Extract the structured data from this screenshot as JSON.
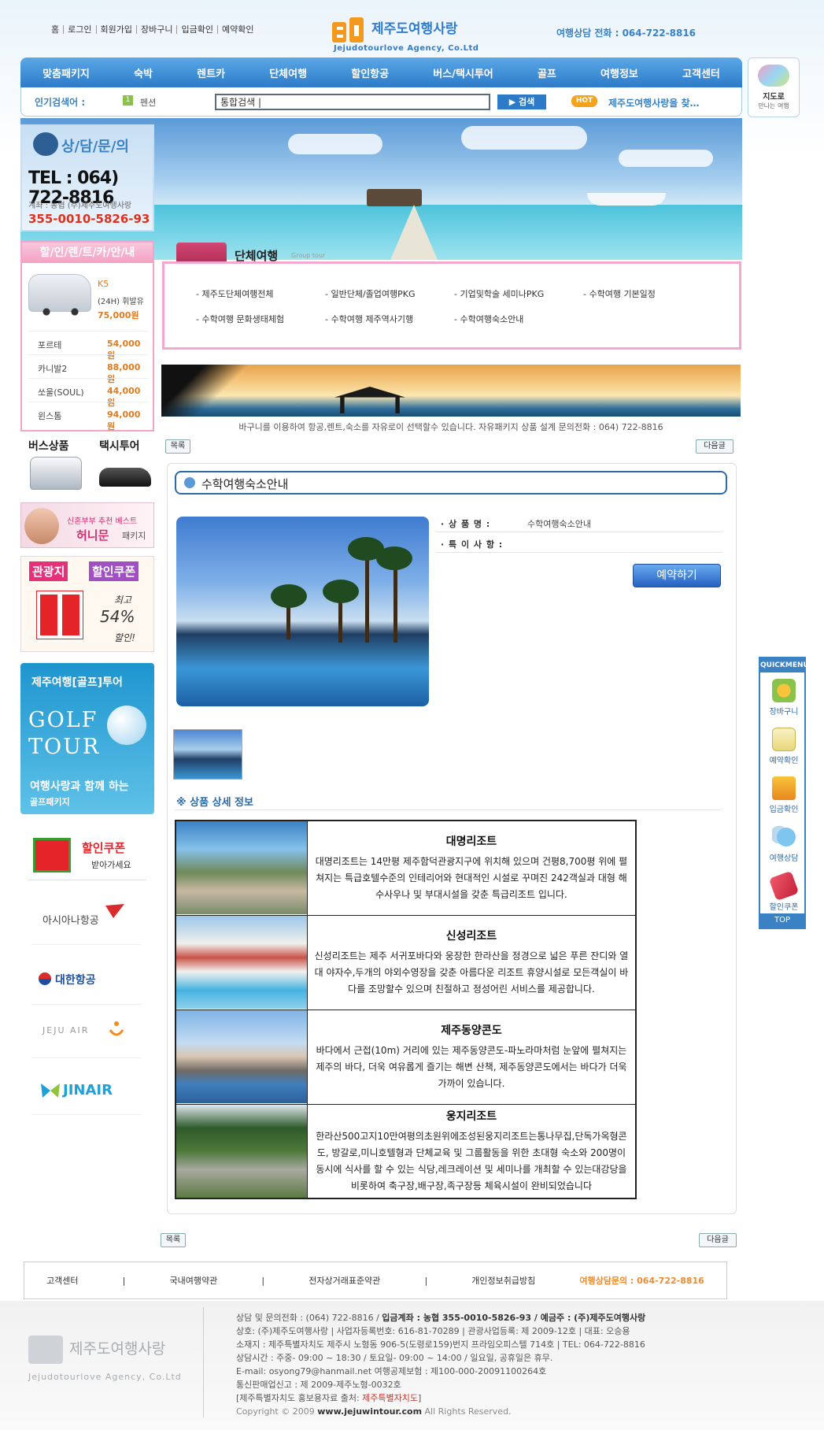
{
  "header": {
    "top_links": [
      "홈",
      "로그인",
      "회원가입",
      "장바구니",
      "입금확인",
      "예약확인"
    ],
    "logo_ko": "제주도여행사랑",
    "logo_en": "Jejudotourlove Agency, Co.Ltd",
    "phone": "여행상담 전화 : 064-722-8816"
  },
  "nav": [
    "맞춤패키지",
    "숙박",
    "렌트카",
    "단체여행",
    "할인항공",
    "버스/택시투어",
    "골프",
    "여행정보",
    "고객센터"
  ],
  "search": {
    "popular_label": "인기검색어 :",
    "popular_rank": "1",
    "popular_word": "펜션",
    "value": "통합검색 |",
    "button": "▶ 검색",
    "hot_badge": "HOT",
    "marquee": "제주도여행사랑을 찾…"
  },
  "map_box": {
    "title": "지도로",
    "sub": "만나는 여행"
  },
  "left": {
    "consult_title": "상/담/문/의",
    "tel": "TEL : 064) 722-8816",
    "account_label": "계좌 : 농협 (주)제주도여행사랑",
    "account": "355-0010-5826-93",
    "rent_title": "할/인/렌/트/카/안/내",
    "featured_car": {
      "name": "K5",
      "fuel": "(24H) 휘발유",
      "price": "75,000원"
    },
    "cars": [
      {
        "name": "포르테",
        "price": "54,000원"
      },
      {
        "name": "카니발2",
        "price": "88,000원"
      },
      {
        "name": "쏘울(SOUL)",
        "price": "44,000원"
      },
      {
        "name": "윈스톰",
        "price": "94,000원"
      }
    ],
    "bus_label": "버스상품",
    "taxi_label": "택시투어",
    "honeymoon": {
      "line1": "신혼부부 추천 베스트",
      "line2": "허니문",
      "line3": "패키지"
    },
    "coupon": {
      "h1": "관광지",
      "h2": "할인쿠폰",
      "max": "최고",
      "pct": "54%",
      "dis": "할인!"
    },
    "golf": {
      "line1": "제주여행[골프]투어",
      "big": "GOLF TOUR",
      "line3": "여행사랑과 함께 하는",
      "line4": "골프패키지"
    },
    "dcoupon": {
      "a": "할인쿠폰",
      "b": "받아가세요"
    },
    "airlines": [
      "아시아나항공",
      "대한항공",
      "JEJU AIR",
      "JINAIR"
    ]
  },
  "group": {
    "title": "단체여행",
    "subtitle": "Group tour",
    "links": [
      "- 제주도단체여행전체",
      "- 일반단체/졸업여행PKG",
      "- 기업및학술 세미나PKG",
      "- 수학여행 기본일정",
      "- 수학여행 문화생태체험",
      "- 수학여행 제주역사기행",
      "- 수학여행숙소안내"
    ]
  },
  "notice": "바구니를 이용하여 항공,렌트,숙소를 자유로이 선택할수 있습니다. 자유패키지 상품 설계 문의전화 : 064) 722-8816",
  "buttons": {
    "list": "목록",
    "next": "다음글"
  },
  "product": {
    "title": "수학여행숙소안내",
    "name_label": "· 상 품 명 :",
    "name_value": "수학여행숙소안내",
    "note_label": "· 특 이 사 항 :",
    "book": "예약하기",
    "detail_header": "※ 상품 상세 정보"
  },
  "resorts": [
    {
      "name": "대명리조트",
      "desc": "대명리조트는 14만평 제주함덕관광지구에 위치해 있으며 건평8,700평 위에 펼쳐지는 특급호텔수준의 인테리어와 현대적인 시설로 꾸며진 242객실과 대형 해수사우나 및 부대시설을 갖춘 특급리조트 입니다."
    },
    {
      "name": "신성리조트",
      "desc": "신성리조트는 제주 서귀포바다와 웅장한 한라산을 정경으로 넓은 푸른 잔디와 열대 야자수,두개의 야외수영장을 갖춘 아름다운 리조트 휴양시설로 모든객실이 바다를 조망할수 있으며 친절하고 정성어린 서비스를 제공합니다."
    },
    {
      "name": "제주동양콘도",
      "desc": "바다에서 근접(10m) 거리에 있는 제주동양콘도-파노라마처럼 눈앞에 펼쳐지는 제주의 바다, 더욱 여유롭게 즐기는 해변 산책, 제주동양콘도에서는 바다가 더욱 가까이 있습니다."
    },
    {
      "name": "웅지리조트",
      "desc": "한라산500고지10만여평의초원위에조성된웅지리조트는통나무집,단독가옥형콘도, 방갈로,미니호텔형과 단체교육 및 그룹활동을 위한 초대형 숙소와 200명이 동시에 식사를 할 수 있는 식당,레크레이션 및 세미나를 개최할 수 있는대강당을 비롯하여 축구장,배구장,족구장등 체육시설이 완비되었습니다"
    }
  ],
  "footer": {
    "links": [
      "고객센터",
      "국내여행약관",
      "전자상거래표준약관",
      "개인정보취급방침"
    ],
    "phone": "여행상담문의 : 064-722-8816",
    "logo_ko": "제주도여행사랑",
    "logo_en": "Jejudotourlove Agency, Co.Ltd",
    "line1a": "상담 및 문의전화 : (064) 722-8816 /",
    "line1b": "입금계좌 : 농협 355-0010-5826-93 / 예금주 : (주)제주도여행사랑",
    "line2": "상호: (주)제주도여행사랑 | 사업자등록번호: 616-81-70289 | 관광사업등록: 제 2009-12호 | 대표: 오승용",
    "line3": "소재지 : 제주특별자치도 제주시 노형동 906-5(도령로159)번지 프라임오피스텔 714호 | TEL: 064-722-8816",
    "line4": "상담시간 : 주중- 09:00 ~ 18:30 / 토요일- 09:00 ~ 14:00 / 일요일, 공휴일은 휴무.",
    "line5": "E-mail: osyong79@hanmail.net 여행공제보험 : 제100-000-20091100264호",
    "line6": "통신판매업신고 : 제 2009-제주노형-0032호",
    "line7a": "[제주특별자치도 홍보용자료 출처:",
    "line7b": "제주특별자치도",
    "line7c": "]",
    "line8a": "Copyright © 2009",
    "line8b": "www.jejuwintour.com",
    "line8c": "All Rights Reserved."
  },
  "quick": {
    "title": "QUICKMENU",
    "items": [
      "장바구니",
      "예약확인",
      "입금확인",
      "여행상담",
      "할인쿠폰"
    ],
    "top": "TOP"
  }
}
